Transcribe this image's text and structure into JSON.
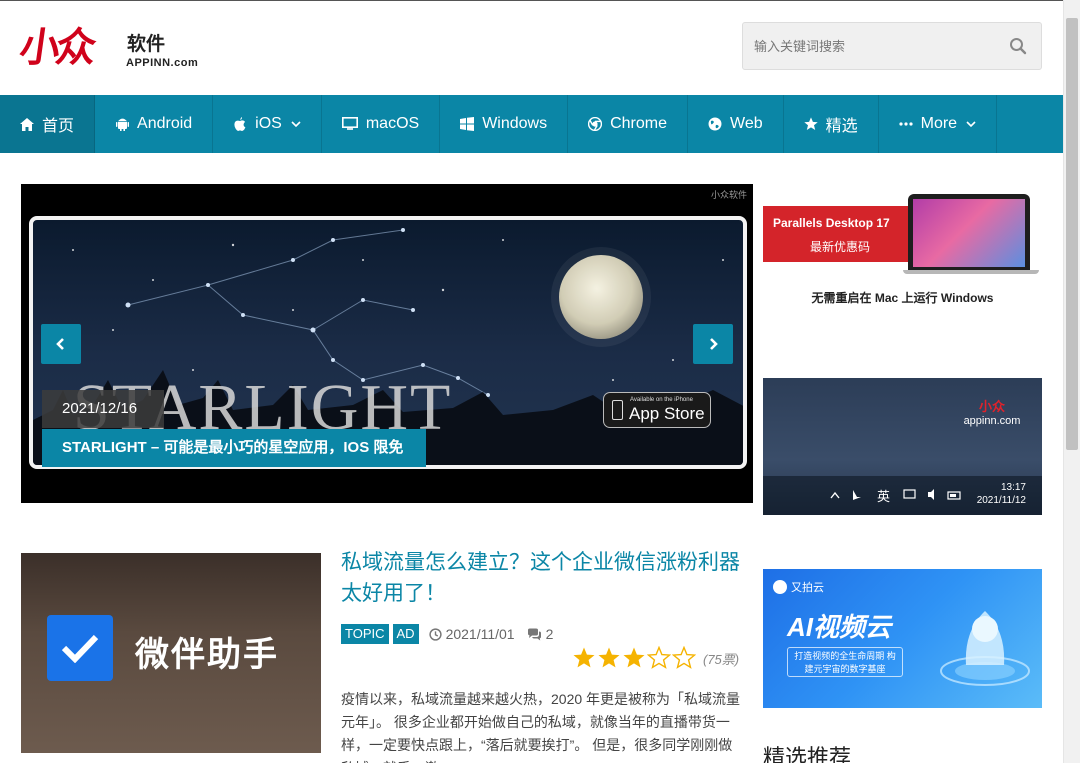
{
  "logo": {
    "mark": "小众",
    "cn": "软件",
    "en": "APPINN.com"
  },
  "search": {
    "placeholder": "输入关键词搜索"
  },
  "nav": [
    {
      "label": "首页",
      "icon": "home-icon",
      "active": true
    },
    {
      "label": "Android",
      "icon": "android-icon"
    },
    {
      "label": "iOS",
      "icon": "apple-icon",
      "dropdown": true
    },
    {
      "label": "macOS",
      "icon": "monitor-icon"
    },
    {
      "label": "Windows",
      "icon": "windows-icon"
    },
    {
      "label": "Chrome",
      "icon": "chrome-icon"
    },
    {
      "label": "Web",
      "icon": "globe-icon"
    },
    {
      "label": "精选",
      "icon": "star-icon"
    },
    {
      "label": "More",
      "icon": "ellipsis-icon",
      "dropdown": true
    }
  ],
  "slider": {
    "watermark": "小众软件",
    "image_text": "STARLIGHT",
    "store_small": "Available on the iPhone",
    "store_big": "App Store",
    "date": "2021/12/16",
    "title": "STARLIGHT – 可能是最小巧的星空应用，IOS 限免"
  },
  "ads": {
    "parallels_title": "Parallels Desktop 17",
    "parallels_sub": "最新优惠码",
    "parallels_caption": "无需重启在 Mac 上运行 Windows",
    "appinn_mark": "小众",
    "appinn_url": "appinn.com",
    "appinn_ime": "英",
    "appinn_time": "13:17",
    "appinn_date": "2021/11/12",
    "paiyun_brand": "又拍云",
    "paiyun_title": "AI视频云",
    "paiyun_sub": "打造视频的全生命周期 构建元宇宙的数字基座"
  },
  "sidebar_heading": "精选推荐",
  "post": {
    "thumb_text": "微伴助手",
    "title": "私域流量怎么建立？这个企业微信涨粉利器太好用了！",
    "tags": [
      "TOPIC",
      "AD"
    ],
    "date": "2021/11/01",
    "comments": "2",
    "rating": 3,
    "rating_max": 5,
    "votes": "(75票)",
    "excerpt": "疫情以来，私域流量越来越火热，2020 年更是被称为「私域流量元年」。 很多企业都开始做自己的私域，就像当年的直播带货一样，一定要快点跟上，“落后就要挨打”。 但是，很多同学刚刚做私域，就手…激"
  },
  "colors": {
    "accent": "#0b86a6",
    "brand_red": "#d0021b",
    "star": "#f5b301"
  }
}
